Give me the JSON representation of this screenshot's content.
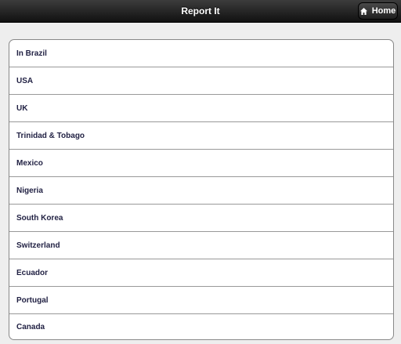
{
  "header": {
    "title": "Report It",
    "home_label": "Home"
  },
  "countries": [
    "In Brazil",
    "USA",
    "UK",
    "Trinidad & Tobago",
    "Mexico",
    "Nigeria",
    "South Korea",
    "Switzerland",
    "Ecuador",
    "Portugal",
    "Canada"
  ],
  "icons": {
    "home": "home-icon"
  },
  "colors": {
    "header": "#1a1a1a",
    "background": "#eeeeee",
    "list_text": "#222244"
  }
}
